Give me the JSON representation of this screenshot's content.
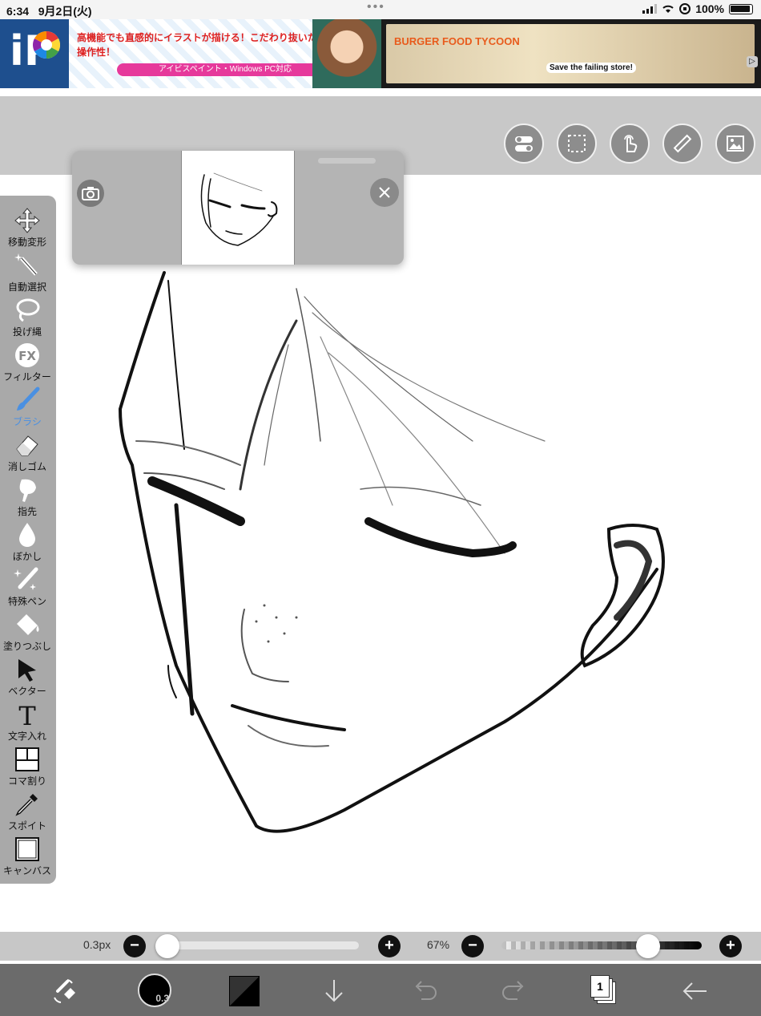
{
  "status_bar": {
    "time": "6:34",
    "date": "9月2日(火)",
    "battery": "100%",
    "dots": "•••"
  },
  "ad": {
    "logo": "iP",
    "copy_line1": "高機能でも直感的にイラストが描ける！こだわり抜いた操作性！",
    "pill": "アイビスペイント・Windows PC対応",
    "game_title": "BURGER FOOD TYCOON",
    "game_tag": "Save the failing store!"
  },
  "tools": [
    {
      "id": "move",
      "label": "移動変形",
      "icon": "move-icon"
    },
    {
      "id": "magic",
      "label": "自動選択",
      "icon": "magic-wand-icon"
    },
    {
      "id": "lasso",
      "label": "投げ縄",
      "icon": "lasso-icon"
    },
    {
      "id": "filter",
      "label": "フィルター",
      "icon": "fx-icon"
    },
    {
      "id": "brush",
      "label": "ブラシ",
      "icon": "brush-icon",
      "active": true
    },
    {
      "id": "eraser",
      "label": "消しゴム",
      "icon": "eraser-icon"
    },
    {
      "id": "smudge",
      "label": "指先",
      "icon": "smudge-icon"
    },
    {
      "id": "blur",
      "label": "ぼかし",
      "icon": "blur-drop-icon"
    },
    {
      "id": "special",
      "label": "特殊ペン",
      "icon": "special-pen-icon"
    },
    {
      "id": "fill",
      "label": "塗りつぶし",
      "icon": "fill-bucket-icon"
    },
    {
      "id": "vector",
      "label": "ベクター",
      "icon": "vector-arrow-icon"
    },
    {
      "id": "text",
      "label": "文字入れ",
      "icon": "text-icon"
    },
    {
      "id": "frame",
      "label": "コマ割り",
      "icon": "frame-divider-icon"
    },
    {
      "id": "eyedropper",
      "label": "スポイト",
      "icon": "eyedropper-icon"
    },
    {
      "id": "canvas",
      "label": "キャンバス",
      "icon": "canvas-icon"
    }
  ],
  "sliders": {
    "size_label": "0.3px",
    "size_fraction": 0.0,
    "opacity_label": "67%",
    "opacity_fraction": 0.67
  },
  "bottom": {
    "brush_size": "0.3",
    "layer_count": "1"
  }
}
